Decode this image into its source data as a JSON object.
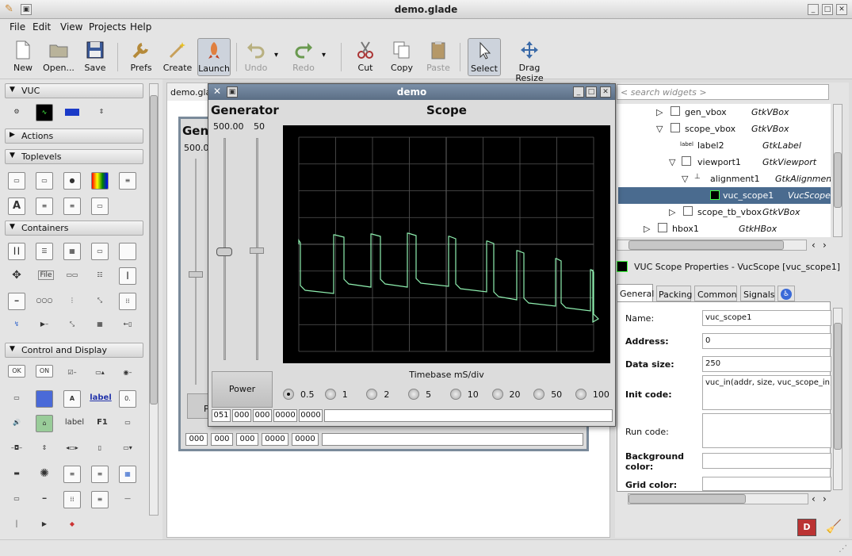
{
  "window": {
    "title": "demo.glade"
  },
  "menu": [
    {
      "label": "File"
    },
    {
      "label": "Edit"
    },
    {
      "label": "View"
    },
    {
      "label": "Projects"
    },
    {
      "label": "Help"
    }
  ],
  "toolbar": {
    "new": "New",
    "open": "Open...",
    "save": "Save",
    "prefs": "Prefs",
    "create": "Create",
    "launch": "Launch",
    "undo": "Undo",
    "redo": "Redo",
    "cut": "Cut",
    "copy": "Copy",
    "paste": "Paste",
    "select": "Select",
    "drag_resize": "Drag Resize"
  },
  "palette": {
    "groups": {
      "vuc": "VUC",
      "actions": "Actions",
      "toplevels": "Toplevels",
      "containers": "Containers",
      "control": "Control and Display"
    },
    "item_labels": {
      "ok": "OK",
      "on": "ON",
      "a": "A",
      "label_link": "label",
      "num": "0.",
      "label_plain": "label",
      "f1": "F1",
      "file": "File"
    }
  },
  "center": {
    "tab": "demo.glade",
    "gen_title": "Gen",
    "gen_value": "500.00",
    "p_label": "P",
    "digits": [
      "000",
      "000",
      "000",
      "0000",
      "0000"
    ]
  },
  "demo": {
    "title": "demo",
    "generator_title": "Generator",
    "slider_values": [
      "500.00",
      "50"
    ],
    "scope_title": "Scope",
    "timebase_label": "Timebase mS/div",
    "power_label": "Power",
    "timebase_options": [
      "0.5",
      "1",
      "2",
      "5",
      "10",
      "20",
      "50",
      "100"
    ],
    "digits": [
      "051",
      "000",
      "000",
      "0000",
      "0000"
    ]
  },
  "inspector": {
    "search_placeholder": "< search widgets >",
    "tree": [
      {
        "name": "gen_vbox",
        "type": "GtkVBox"
      },
      {
        "name": "scope_vbox",
        "type": "GtkVBox"
      },
      {
        "name": "label2",
        "type": "GtkLabel"
      },
      {
        "name": "viewport1",
        "type": "GtkViewport"
      },
      {
        "name": "alignment1",
        "type": "GtkAlignment"
      },
      {
        "name": "vuc_scope1",
        "type": "VucScope"
      },
      {
        "name": "scope_tb_vbox",
        "type": "GtkVBox"
      },
      {
        "name": "hbox1",
        "type": "GtkHBox"
      }
    ],
    "properties_title": "VUC Scope Properties - VucScope [vuc_scope1]",
    "tabs": [
      "General",
      "Packing",
      "Common",
      "Signals"
    ],
    "fields": {
      "name_label": "Name:",
      "name_value": "vuc_scope1",
      "address_label": "Address:",
      "address_value": "0",
      "datasize_label": "Data size:",
      "datasize_value": "250",
      "init_label": "Init code:",
      "init_value": "vuc_in(addr, size, vuc_scope_in, o",
      "run_label": "Run code:",
      "run_value": "",
      "bg_label": "Background color:",
      "bg_value": "",
      "grid_label": "Grid color:",
      "grid_value": ""
    }
  },
  "colors": {
    "accent": "#4a6b8f",
    "trace": "#8ff0b0",
    "scope_bg": "#000000",
    "grid": "#555555"
  }
}
